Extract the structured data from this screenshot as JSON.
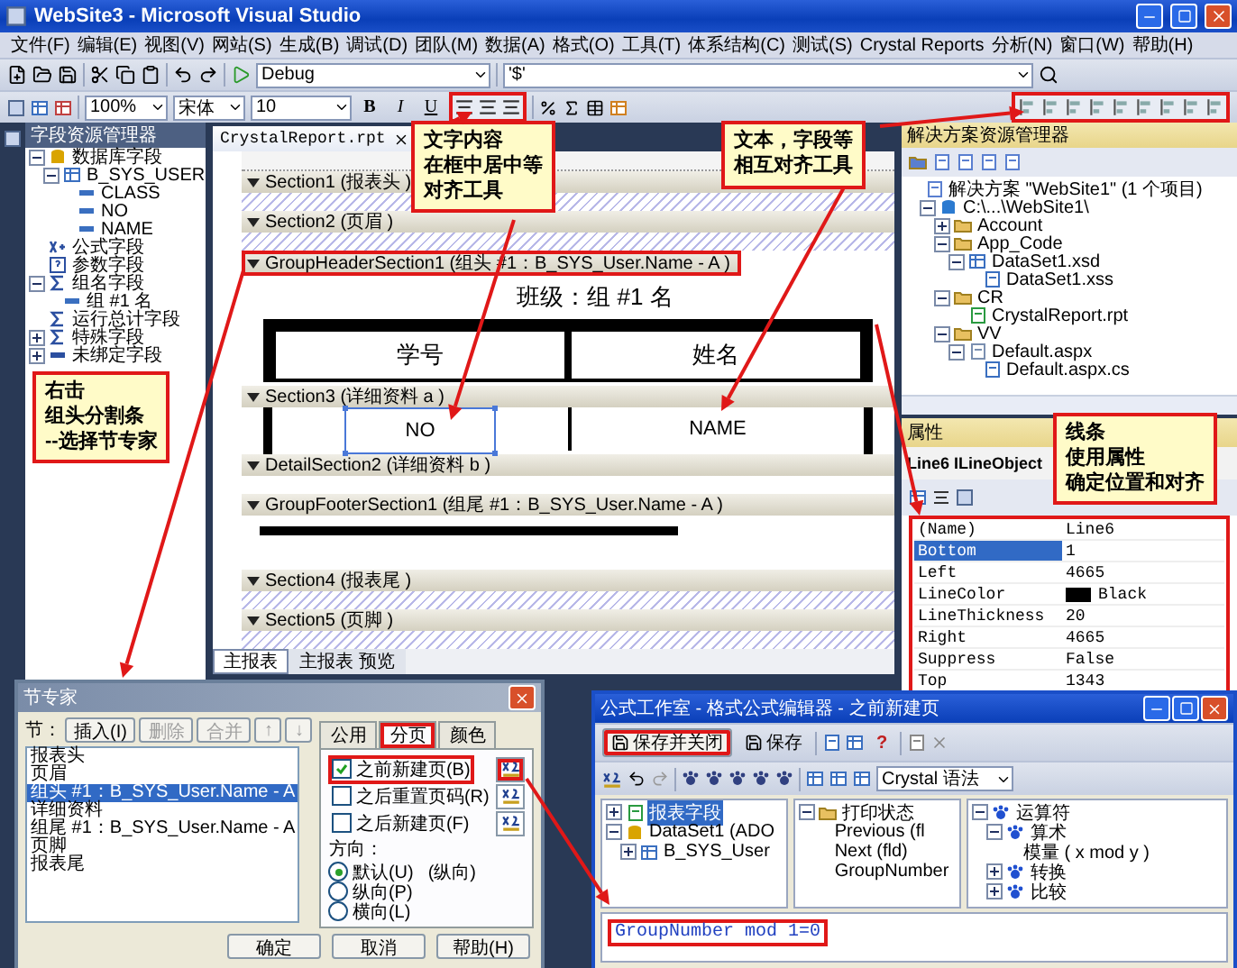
{
  "window": {
    "title": "WebSite3 - Microsoft Visual Studio"
  },
  "menu": [
    "文件(F)",
    "编辑(E)",
    "视图(V)",
    "网站(S)",
    "生成(B)",
    "调试(D)",
    "团队(M)",
    "数据(A)",
    "格式(O)",
    "工具(T)",
    "体系结构(C)",
    "测试(S)",
    "Crystal Reports",
    "分析(N)",
    "窗口(W)",
    "帮助(H)"
  ],
  "toolbar": {
    "configuration": "Debug",
    "find_text": "'$'",
    "zoom": "100%",
    "font": "宋体",
    "font_size": "10",
    "bold": "B",
    "italic": "I",
    "underline": "U"
  },
  "field_explorer": {
    "title": "字段资源管理器",
    "tree": [
      {
        "label": "数据库字段",
        "kind": "database",
        "expanded": true,
        "children": [
          {
            "label": "B_SYS_USER",
            "kind": "table",
            "expanded": true,
            "children": [
              {
                "label": "CLASS",
                "kind": "field"
              },
              {
                "label": "NO",
                "kind": "field"
              },
              {
                "label": "NAME",
                "kind": "field"
              }
            ]
          }
        ]
      },
      {
        "label": "公式字段",
        "kind": "formula"
      },
      {
        "label": "参数字段",
        "kind": "parameter"
      },
      {
        "label": "组名字段",
        "kind": "group",
        "expanded": true,
        "children": [
          {
            "label": "组 #1 名",
            "kind": "field"
          }
        ]
      },
      {
        "label": "运行总计字段",
        "kind": "total"
      },
      {
        "label": "特殊字段",
        "kind": "special",
        "expanded": false
      },
      {
        "label": "未绑定字段",
        "kind": "unbound",
        "expanded": false
      }
    ]
  },
  "document_tab": {
    "label": "CrystalReport.rpt"
  },
  "report": {
    "sections": [
      {
        "kind": "hatched",
        "label": "Section1 (报表头 )",
        "highlighted": false
      },
      {
        "kind": "hatched",
        "label": "Section2 (页眉 )",
        "highlighted": false
      },
      {
        "kind": "group_header",
        "label": "GroupHeaderSection1 (组头 #1：B_SYS_User.Name - A )",
        "highlighted": true,
        "title": "班级：组 #1 名",
        "cells": [
          {
            "text": "学号",
            "selected": false
          },
          {
            "text": "姓名",
            "selected": false
          }
        ]
      },
      {
        "kind": "detail",
        "label": "Section3 (详细资料 a )",
        "highlighted": false,
        "cells": [
          {
            "text": "NO",
            "selected": true
          },
          {
            "text": "NAME",
            "selected": false
          }
        ]
      },
      {
        "kind": "empty",
        "label": "DetailSection2 (详细资料 b )",
        "highlighted": false
      },
      {
        "kind": "group_footer",
        "label": "GroupFooterSection1 (组尾 #1：B_SYS_User.Name - A )",
        "highlighted": false
      },
      {
        "kind": "hatched",
        "label": "Section4 (报表尾 )",
        "highlighted": false
      },
      {
        "kind": "hatched",
        "label": "Section5 (页脚 )",
        "highlighted": false
      }
    ]
  },
  "view_tabs": [
    {
      "label": "主报表",
      "selected": true
    },
    {
      "label": "主报表 预览",
      "selected": false
    }
  ],
  "solution_explorer": {
    "title": "解决方案资源管理器",
    "tree": [
      {
        "label": "解决方案 \"WebSite1\" (1 个项目)",
        "kind": "solution",
        "children": [
          {
            "label": "C:\\...\\WebSite1\\",
            "kind": "project",
            "expanded": true,
            "children": [
              {
                "label": "Account",
                "kind": "folder",
                "expanded": false
              },
              {
                "label": "App_Code",
                "kind": "folder",
                "expanded": true,
                "children": [
                  {
                    "label": "DataSet1.xsd",
                    "kind": "dataset",
                    "expanded": true,
                    "children": [
                      {
                        "label": "DataSet1.xss",
                        "kind": "file"
                      }
                    ]
                  }
                ]
              },
              {
                "label": "CR",
                "kind": "folder",
                "expanded": true,
                "children": [
                  {
                    "label": "CrystalReport.rpt",
                    "kind": "report"
                  }
                ]
              },
              {
                "label": "VV",
                "kind": "folder",
                "expanded": true,
                "children": [
                  {
                    "label": "Default.aspx",
                    "kind": "page",
                    "expanded": true,
                    "children": [
                      {
                        "label": "Default.aspx.cs",
                        "kind": "file"
                      }
                    ]
                  }
                ]
              }
            ]
          }
        ]
      }
    ]
  },
  "properties": {
    "title": "属性",
    "object": "Line6 ILineObject",
    "rows": [
      {
        "name": "(Name)",
        "value": "Line6",
        "selected": false
      },
      {
        "name": "Bottom",
        "value": "1",
        "selected": true
      },
      {
        "name": "Left",
        "value": "4665",
        "selected": false
      },
      {
        "name": "LineColor",
        "value": "Black",
        "color": "#000000",
        "selected": false
      },
      {
        "name": "LineThickness",
        "value": "20",
        "selected": false
      },
      {
        "name": "Right",
        "value": "4665",
        "selected": false
      },
      {
        "name": "Suppress",
        "value": "False",
        "selected": false
      },
      {
        "name": "Top",
        "value": "1343",
        "selected": false
      }
    ]
  },
  "callouts": [
    {
      "lines": [
        "文字内容",
        "在框中居中等",
        "对齐工具"
      ]
    },
    {
      "lines": [
        "文本，字段等",
        "相互对齐工具"
      ]
    },
    {
      "lines": [
        "右击",
        "组头分割条",
        "--选择节专家"
      ]
    },
    {
      "lines": [
        "线条",
        "使用属性",
        "确定位置和对齐"
      ]
    }
  ],
  "section_expert": {
    "title": "节专家",
    "label": "节：",
    "actions": [
      {
        "label": "插入(I)",
        "disabled": false
      },
      {
        "label": "删除",
        "disabled": true
      },
      {
        "label": "合并",
        "disabled": true
      },
      {
        "label": "↑",
        "disabled": true
      },
      {
        "label": "↓",
        "disabled": true
      }
    ],
    "sections": [
      {
        "label": "报表头",
        "selected": false
      },
      {
        "label": "页眉",
        "selected": false
      },
      {
        "label": "组头 #1：B_SYS_User.Name - A",
        "selected": true
      },
      {
        "label": "详细资料",
        "selected": false
      },
      {
        "label": "组尾 #1：B_SYS_User.Name - A",
        "selected": false
      },
      {
        "label": "页脚",
        "selected": false
      },
      {
        "label": "报表尾",
        "selected": false
      }
    ],
    "tabs": [
      {
        "label": "公用",
        "selected": false,
        "highlighted": false
      },
      {
        "label": "分页",
        "selected": true,
        "highlighted": true
      },
      {
        "label": "颜色",
        "selected": false,
        "highlighted": false
      }
    ],
    "options": [
      {
        "label": "之前新建页(B)",
        "checked": true,
        "highlighted": true
      },
      {
        "label": "之后重置页码(R)",
        "checked": false,
        "highlighted": false
      },
      {
        "label": "之后新建页(F)",
        "checked": false,
        "highlighted": false
      }
    ],
    "orientation_label": "方向：",
    "orientation": [
      {
        "label": "默认(U)",
        "note": "(纵向)",
        "selected": true
      },
      {
        "label": "纵向(P)",
        "selected": false
      },
      {
        "label": "横向(L)",
        "selected": false
      }
    ],
    "buttons": [
      "确定",
      "取消",
      "帮助(H)"
    ]
  },
  "formula_workshop": {
    "title": "公式工作室 - 格式公式编辑器 - 之前新建页",
    "save_close": "保存并关闭",
    "save": "保存",
    "help": "?",
    "syntax": "Crystal 语法",
    "panes": [
      {
        "tree": [
          {
            "label": "报表字段",
            "kind": "report",
            "selected": true,
            "expanded": false
          },
          {
            "label": "DataSet1 (ADO",
            "kind": "database",
            "selected": false,
            "expanded": true,
            "children": [
              {
                "label": "B_SYS_User",
                "kind": "table",
                "selected": false,
                "expanded": false
              }
            ]
          }
        ]
      },
      {
        "tree": [
          {
            "label": "打印状态",
            "kind": "folder",
            "expanded": true,
            "children": [
              {
                "label": "Previous (fl"
              },
              {
                "label": "Next (fld)"
              },
              {
                "label": "GroupNumber"
              }
            ]
          }
        ]
      },
      {
        "tree": [
          {
            "label": "运算符",
            "kind": "operator",
            "expanded": true,
            "children": [
              {
                "label": "算术",
                "kind": "operator",
                "expanded": true,
                "children": [
                  {
                    "label": "模量 ( x mod y )"
                  }
                ]
              },
              {
                "label": "转换",
                "kind": "operator",
                "expanded": false
              },
              {
                "label": "比较",
                "kind": "operator",
                "expanded": false
              }
            ]
          }
        ]
      }
    ],
    "formula": "GroupNumber mod 1=0"
  }
}
